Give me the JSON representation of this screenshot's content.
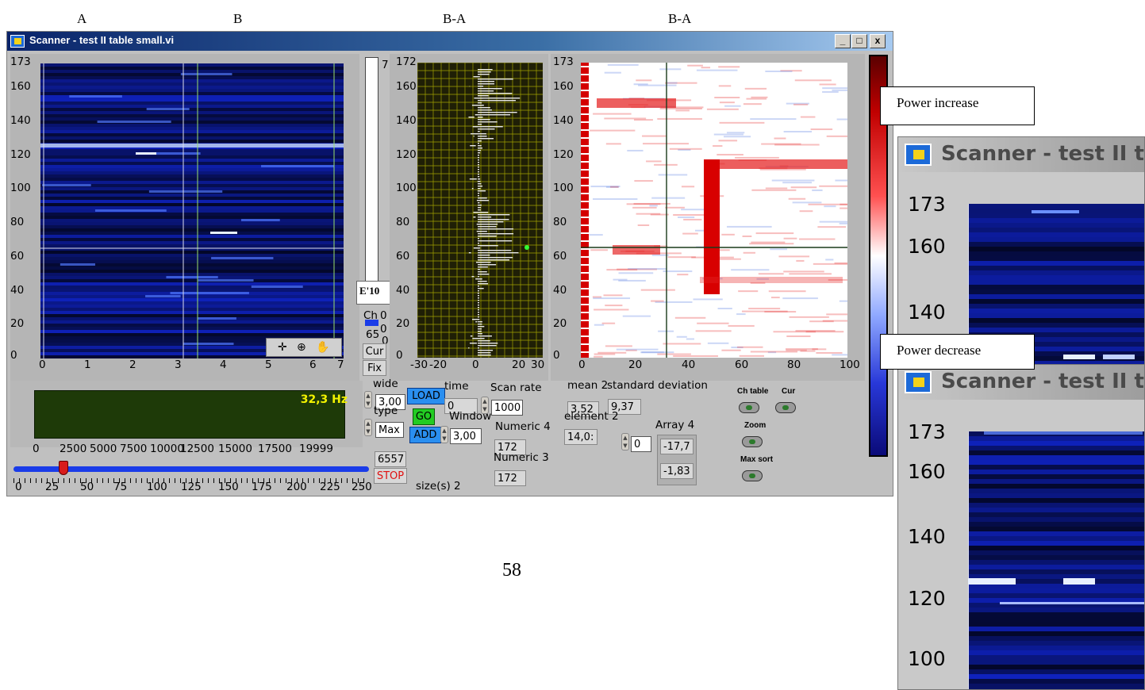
{
  "column_labels": [
    "A",
    "B",
    "B-A",
    "B-A"
  ],
  "window": {
    "title": "Scanner - test II table small.vi",
    "buttons": [
      "_",
      "□",
      "x"
    ]
  },
  "plot_a": {
    "y_ticks": [
      "173",
      "160",
      "140",
      "120",
      "100",
      "80",
      "60",
      "40",
      "20",
      "0"
    ],
    "x_ticks": [
      "0",
      "1",
      "2",
      "3",
      "4",
      "5",
      "6",
      "7"
    ]
  },
  "scale_bar": {
    "top_label": "7",
    "exp_label": "E'10",
    "ch_label": "Ch",
    "side_ticks": [
      "0",
      "0"
    ],
    "ch_value": "65",
    "ch_value_suffix": "0",
    "cur_label": "Cur",
    "fix_label": "Fix"
  },
  "plot_profile": {
    "y_ticks": [
      "172",
      "160",
      "140",
      "120",
      "100",
      "80",
      "60",
      "40",
      "20",
      "0"
    ],
    "x_ticks": [
      "-30",
      "-20",
      "0",
      "20",
      "30"
    ]
  },
  "plot_diff": {
    "y_ticks": [
      "173",
      "160",
      "140",
      "120",
      "100",
      "80",
      "60",
      "40",
      "20",
      "0"
    ],
    "x_ticks": [
      "0",
      "20",
      "40",
      "60",
      "80",
      "100"
    ]
  },
  "freq_display": {
    "value": "32,3 Hz",
    "axis_ticks": [
      "0",
      "2500",
      "5000",
      "7500",
      "10000",
      "12500",
      "15000",
      "17500",
      "19999"
    ]
  },
  "slider": {
    "ticks": [
      "0",
      "25",
      "50",
      "75",
      "100",
      "125",
      "150",
      "175",
      "200",
      "225",
      "250"
    ],
    "value_fraction": 0.14
  },
  "controls": {
    "wide_label": "wide",
    "wide_value": "3,00",
    "type_label": "type",
    "type_value": "Max",
    "counter_value": "6557",
    "stop_label": "STOP",
    "load_label": "LOAD",
    "go_label": "GO",
    "add_label": "ADD",
    "time_label": "time",
    "time_value": "0",
    "window_label": "Window",
    "window_value": "3,00",
    "scan_rate_label": "Scan rate",
    "scan_rate_value": "1000",
    "numeric4_label": "Numeric 4",
    "numeric4_value": "172",
    "numeric3_label": "Numeric 3",
    "numeric3_value": "172",
    "sizes_label": "size(s) 2",
    "mean_label": "mean 2",
    "mean_value": "3,52",
    "std_label": "standard deviation",
    "std_value": "9,37",
    "element_label": "element 2",
    "element_value": "14,0:",
    "array_label": "Array 4",
    "array_index": "0",
    "array_values": [
      "-17,7",
      "-1,83"
    ],
    "ch_table_label": "Ch table",
    "cur_toggle_label": "Cur",
    "zoom_label": "Zoom",
    "max_sort_label": "Max sort"
  },
  "callouts": {
    "increase": "Power increase",
    "decrease": "Power decrease"
  },
  "zoom_windows": {
    "title": "Scanner - test II ta",
    "upper_ticks": [
      "173",
      "160",
      "140"
    ],
    "lower_ticks": [
      "173",
      "160",
      "140",
      "120",
      "100"
    ]
  },
  "page_number": "58",
  "colors": {
    "window_bg": "#c0c0c0",
    "heatmap_bg": "#0d1a5c",
    "profile_bg": "#1f1f06",
    "grid": "#a3a300",
    "increase": "#e00000",
    "decrease": "#5b7fd6",
    "freq_display_bg": "#1e3a08",
    "freq_text": "#f2f200",
    "slider": "#1a3ce8",
    "load_button": "#2a8ff0",
    "go_button": "#22cc22",
    "stop_text": "#e01010"
  }
}
